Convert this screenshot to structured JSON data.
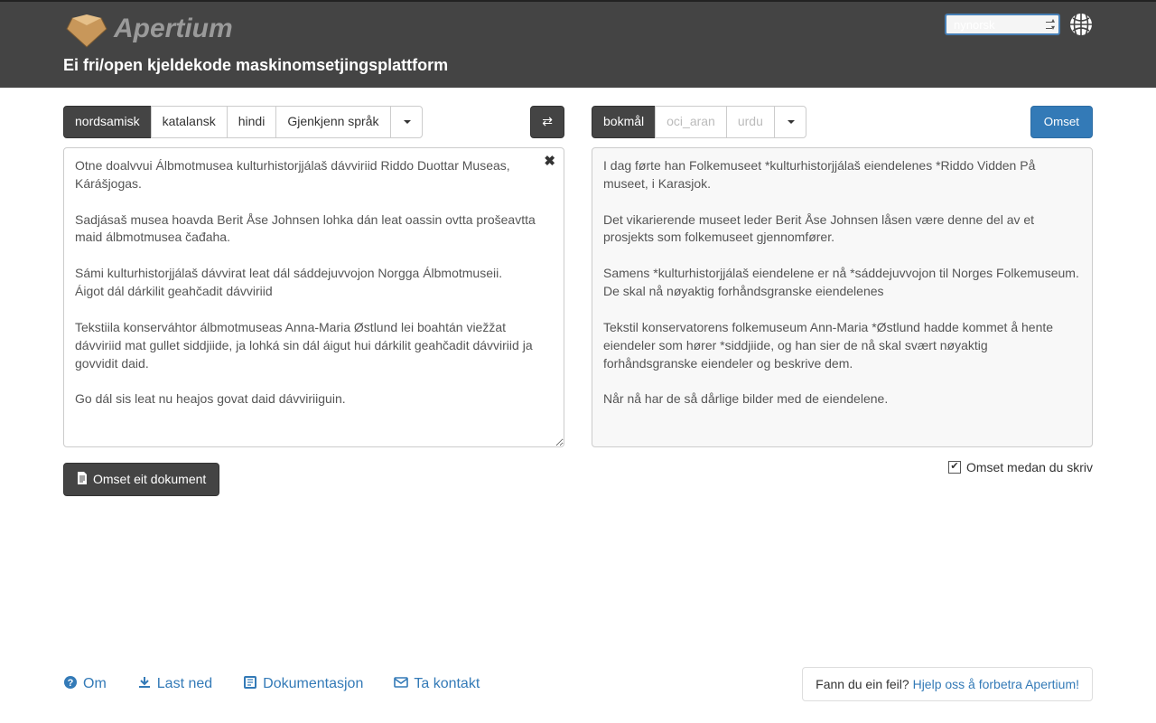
{
  "header": {
    "logo_title": "Apertium",
    "subtitle": "Ei fri/open kjeldekode maskinomsetjingsplattform",
    "ui_lang": "nynorsk"
  },
  "source": {
    "langs": [
      "nordsamisk",
      "katalansk",
      "hindi"
    ],
    "active": 0,
    "detect_label": "Gjenkjenn språk",
    "text": "Otne doalvvui Álbmotmusea kulturhistorjjálaš dávviriid Riddo Duottar Museas, Kárášjogas.\n\nSadjásaš musea hoavda Berit Åse Johnsen lohka dán leat oassin ovtta prošeavtta maid álbmotmusea čađaha.\n\nSámi kulturhistorjjálaš dávvirat leat dál sáddejuvvojon Norgga Álbmotmuseii.\nÁigot dál dárkilit geahčadit dávviriid\n\nTekstiila konserváhtor álbmotmuseas Anna-Maria Østlund lei boahtán viežžat dávviriid mat gullet siddjiide, ja lohká sin dál áigut hui dárkilit geahčadit dávviriid ja govvidit daid.\n\nGo dál sis leat nu heajos govat daid dávviriiguin."
  },
  "target": {
    "langs": [
      "bokmål",
      "oci_aran",
      "urdu"
    ],
    "active": 0,
    "translate_label": "Omset",
    "text": "I dag førte han Folkemuseet *kulturhistorjjálaš eiendelenes *Riddo Vidden På museet, i Karasjok.\n\nDet vikarierende museet leder Berit Åse Johnsen låsen være denne del av et prosjekts som folkemuseet gjennomfører.\n\nSamens *kulturhistorjjálaš eiendelene er nå *sáddejuvvojon til Norges Folkemuseum.\nDe skal nå nøyaktig forhåndsgranske eiendelenes\n\nTekstil konservatorens folkemuseum Ann-Maria *Østlund hadde kommet å hente eiendeler som hører *siddjiide, og han sier de nå skal svært nøyaktig forhåndsgranske eiendeler og beskrive dem.\n\nNår nå har de så dårlige bilder med de eiendelene."
  },
  "actions": {
    "doc_translate": "Omset eit dokument",
    "instant_label": "Omset medan du skriv",
    "instant_checked": true
  },
  "footer": {
    "about": "Om",
    "download": "Last ned",
    "documentation": "Dokumentasjon",
    "contact": "Ta kontakt",
    "feedback_prefix": "Fann du ein feil? ",
    "feedback_link": "Hjelp oss å forbetra Apertium!"
  }
}
